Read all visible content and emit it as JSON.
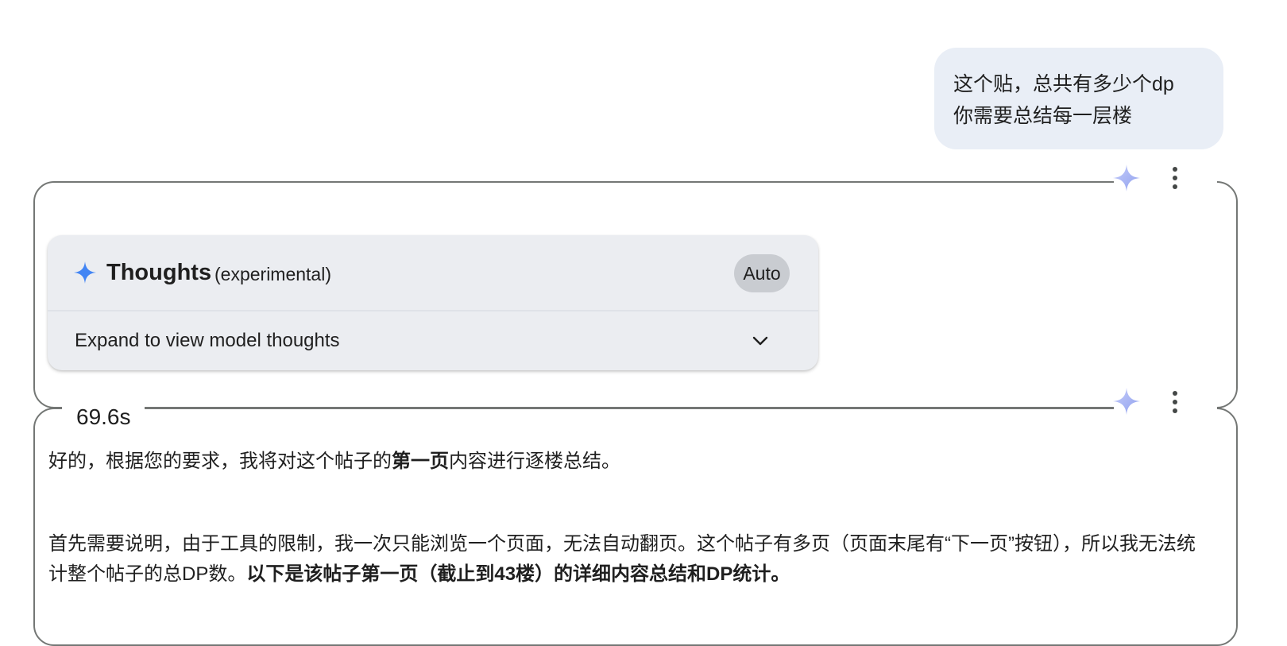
{
  "user_message": {
    "line1": "这个贴，总共有多少个dp",
    "line2": "你需要总结每一层楼"
  },
  "thoughts": {
    "title": "Thoughts",
    "subtitle": "(experimental)",
    "mode_badge": "Auto",
    "expand_label": "Expand to view model thoughts",
    "duration": "69.6s"
  },
  "response": {
    "p1_before": "好的，根据您的要求，我将对这个帖子的",
    "p1_bold": "第一页",
    "p1_after": "内容进行逐楼总结。",
    "p2_text": "首先需要说明，由于工具的限制，我一次只能浏览一个页面，无法自动翻页。这个帖子有多页（页面末尾有“下一页”按钮），所以我无法统计整个帖子的总DP数。",
    "p2_bold": "以下是该帖子第一页（截止到43楼）的详细内容总结和DP统计。"
  },
  "colors": {
    "user_bubble": "#e9eef6",
    "card": "#ebedf1",
    "badge": "#c9ccd1",
    "frame_border": "#747775",
    "sparkle": "#4285f4"
  },
  "icons": [
    "sparkle-icon",
    "more-vert-icon",
    "chevron-down-icon"
  ]
}
